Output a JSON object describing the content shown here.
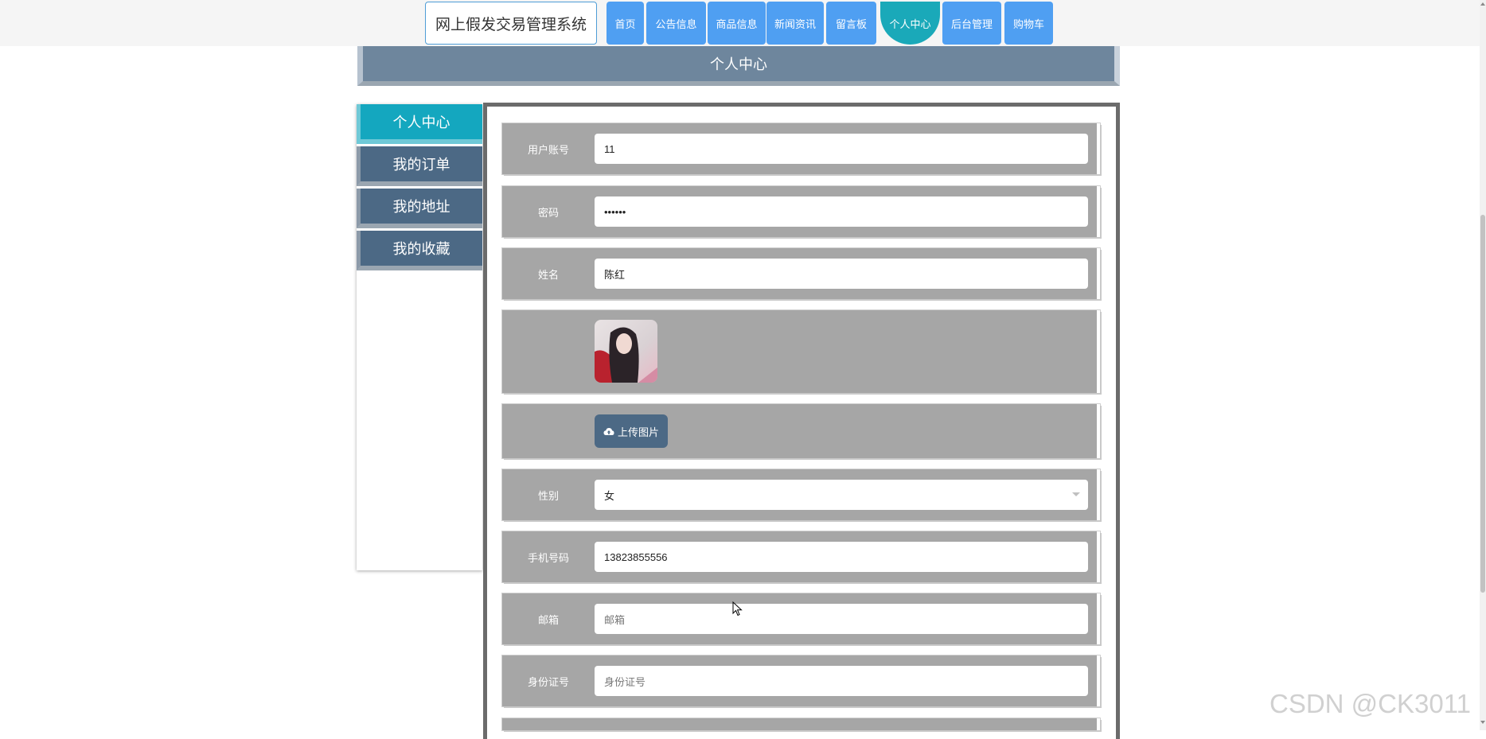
{
  "header": {
    "site_title": "网上假发交易管理系统",
    "nav": [
      {
        "label": "首页"
      },
      {
        "label": "公告信息"
      },
      {
        "label": "商品信息"
      },
      {
        "label": "新闻资讯"
      },
      {
        "label": "留言板"
      },
      {
        "label": "个人中心",
        "active": true
      },
      {
        "label": "后台管理"
      },
      {
        "label": "购物车"
      }
    ]
  },
  "banner": {
    "title": "个人中心"
  },
  "sidebar": {
    "items": [
      {
        "label": "个人中心",
        "active": true
      },
      {
        "label": "我的订单"
      },
      {
        "label": "我的地址"
      },
      {
        "label": "我的收藏"
      }
    ]
  },
  "form": {
    "username": {
      "label": "用户账号",
      "value": "11"
    },
    "password": {
      "label": "密码",
      "value": "••••••"
    },
    "name": {
      "label": "姓名",
      "value": "陈红"
    },
    "upload": {
      "label": "上传图片",
      "icon": "cloud-upload-icon"
    },
    "gender": {
      "label": "性别",
      "value": "女"
    },
    "phone": {
      "label": "手机号码",
      "value": "13823855556"
    },
    "email": {
      "label": "邮箱",
      "placeholder": "邮箱"
    },
    "id_card": {
      "label": "身份证号",
      "placeholder": "身份证号"
    }
  },
  "watermark": "CSDN @CK3011",
  "colors": {
    "nav_bg": "#4f9ff2",
    "nav_active": "#1aa9b9",
    "sidebar_bg": "#4c6985",
    "sidebar_active": "#14a7bf",
    "row_bg": "#a6a6a6",
    "banner_bg": "#6e869d"
  }
}
